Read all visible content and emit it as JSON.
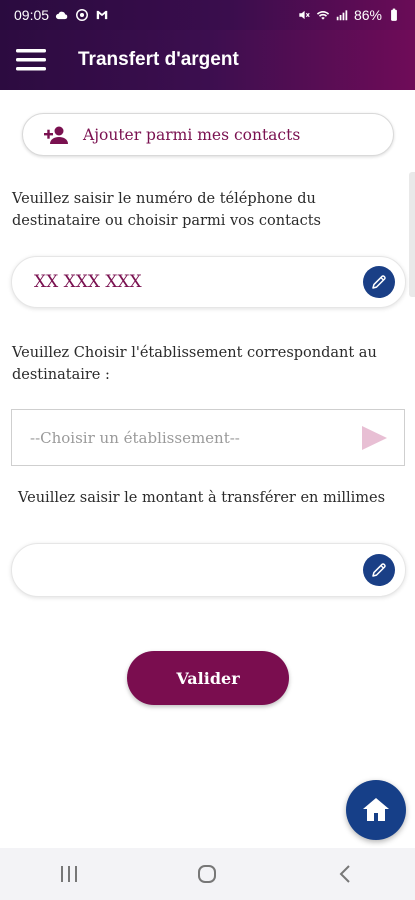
{
  "status_bar": {
    "time": "09:05",
    "battery": "86%"
  },
  "app_bar": {
    "title": "Transfert d'argent"
  },
  "contacts_button": {
    "label": "Ajouter parmi mes contacts"
  },
  "phone": {
    "instruction": "Veuillez saisir le numéro de téléphone du destinataire ou choisir parmi vos contacts",
    "placeholder": "XX XXX XXX"
  },
  "establishment": {
    "instruction": "Veuillez Choisir l'établissement correspondant au destinataire :",
    "placeholder": "--Choisir un établissement--"
  },
  "amount": {
    "instruction": "Veuillez saisir le montant à transférer en millimes",
    "value": ""
  },
  "submit": {
    "label": "Valider"
  },
  "colors": {
    "primary": "#7a0d4f",
    "header_start": "#2c0b40",
    "header_end": "#6f0c58",
    "accent_blue": "#1a3f86"
  }
}
